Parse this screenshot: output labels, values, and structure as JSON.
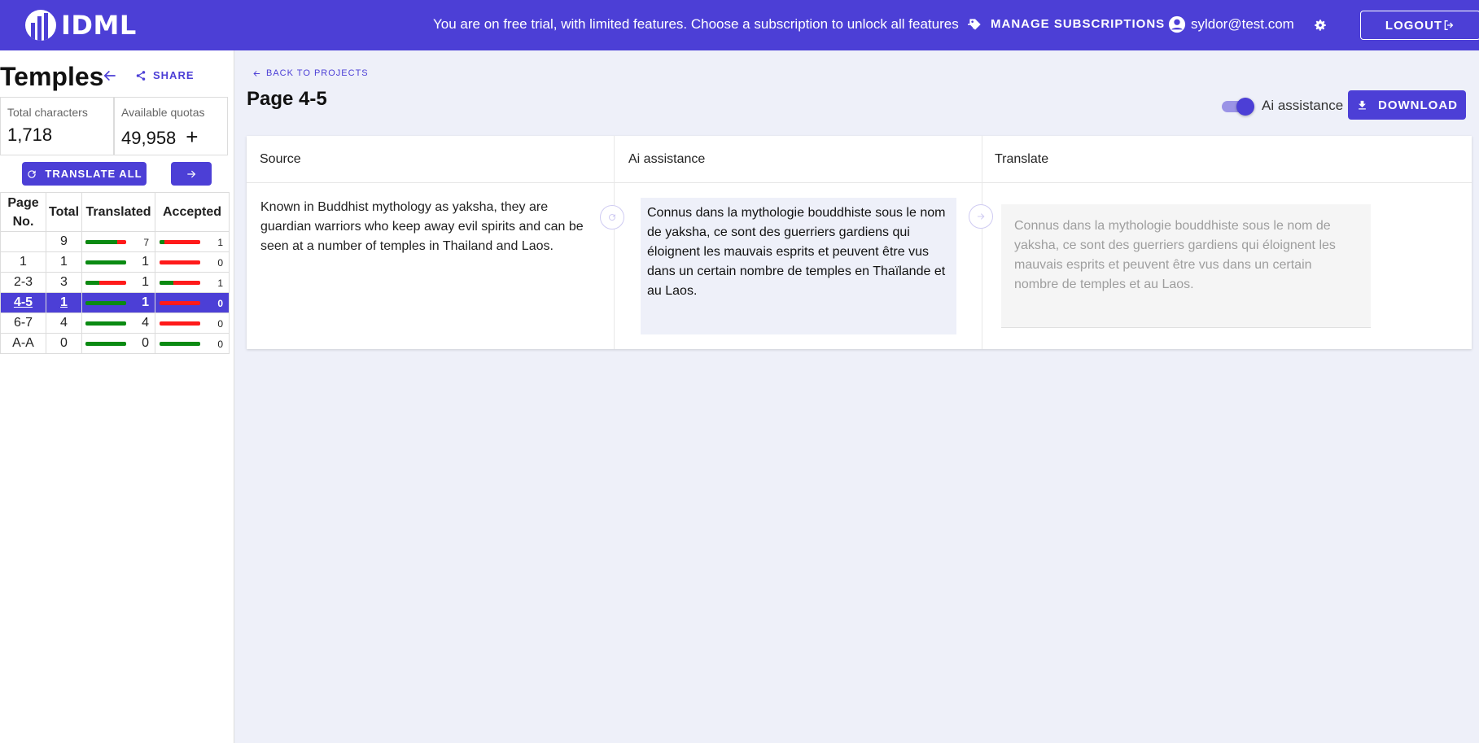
{
  "app": {
    "name": "IDML"
  },
  "header": {
    "trial_message": "You are on free trial, with limited features. Choose a subscription to unlock all features",
    "manage_label": "MANAGE SUBSCRIPTIONS",
    "user_email": "syldor@test.com",
    "logout_label": "LOGOUT"
  },
  "sidebar": {
    "project_title": "Temples",
    "share_label": "SHARE",
    "stats": {
      "total_label": "Total characters",
      "total_value": "1,718",
      "quota_label": "Available quotas",
      "quota_value": "49,958",
      "quota_add": "+"
    },
    "translate_all_label": "TRANSLATE ALL",
    "table": {
      "headers": [
        "Page No.",
        "Total",
        "Translated",
        "Accepted"
      ],
      "rows": [
        {
          "page": "",
          "total": "9",
          "translated": "7",
          "translated_ratio": 0.78,
          "accepted": "1",
          "accepted_ratio": 0.11
        },
        {
          "page": "1",
          "total": "1",
          "translated": "1",
          "translated_ratio": 1.0,
          "accepted": "0",
          "accepted_ratio": 0.0
        },
        {
          "page": "2-3",
          "total": "3",
          "translated": "1",
          "translated_ratio": 0.33,
          "accepted": "1",
          "accepted_ratio": 0.33
        },
        {
          "page": "4-5",
          "total": "1",
          "translated": "1",
          "translated_ratio": 1.0,
          "accepted": "0",
          "accepted_ratio": 0.0,
          "active": true
        },
        {
          "page": "6-7",
          "total": "4",
          "translated": "4",
          "translated_ratio": 1.0,
          "accepted": "0",
          "accepted_ratio": 0.0
        },
        {
          "page": "A-A",
          "total": "0",
          "translated": "0",
          "translated_ratio": 1.0,
          "accepted": "0",
          "accepted_ratio": 1.0
        }
      ]
    }
  },
  "main": {
    "back_label": "BACK TO PROJECTS",
    "page_title": "Page 4-5",
    "ai_toggle_label": "Ai assistance",
    "ai_toggle_on": true,
    "download_label": "DOWNLOAD",
    "columns": [
      "Source",
      "Ai assistance",
      "Translate"
    ],
    "segment": {
      "source": "Known in Buddhist mythology as yaksha, they are guardian warriors who keep away evil spirits and can be seen at a number of temples in Thailand and Laos.",
      "ai": "Connus dans la mythologie bouddhiste sous le nom de yaksha, ce sont des guerriers gardiens qui éloignent les mauvais esprits et peuvent être vus dans un certain nombre de temples en Thaïlande et au Laos.",
      "translate_placeholder": "Connus dans la mythologie bouddhiste sous le nom de yaksha, ce sont des guerriers gardiens qui éloignent les mauvais esprits et peuvent être vus dans un certain nombre de temples et au Laos."
    }
  },
  "colors": {
    "primary": "#4c3fd6",
    "good": "#0a8a12",
    "bad": "#ff1a1a",
    "background": "#eef0f9"
  },
  "icons": [
    "logo-icon",
    "arrow-right-icon",
    "tag-icon",
    "account-circle-icon",
    "gear-icon",
    "logout-icon",
    "arrow-left-icon",
    "share-icon",
    "refresh-icon",
    "download-icon"
  ]
}
